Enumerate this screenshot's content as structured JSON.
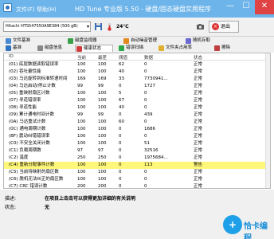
{
  "window": {
    "title": "HD Tune 专业版 5.50 - 硬盘/固态硬盘实用程序",
    "menu": [
      "文件(F)",
      "帮助(H)"
    ],
    "controls": {
      "minimize": "—",
      "maximize": "☐",
      "close": "✕"
    }
  },
  "toolbar": {
    "drive": "Hitachi HTS547550A9E384 (500 gB)",
    "temperature": "24℃",
    "exit_label": "退出"
  },
  "tabs": {
    "row1": [
      "文件基准",
      "磁盘监视器",
      "自动噪音管理",
      "随机存取"
    ],
    "row2": [
      "基准",
      "磁盘信息",
      "健康状态",
      "错误扫描",
      "文件夹占用率",
      "擦除"
    ]
  },
  "table": {
    "headers": [
      "ID",
      "当前",
      "最差",
      "阈值",
      "数据",
      "状态"
    ],
    "rows": [
      [
        "(01) 底层数据读取错误率",
        "100",
        "100",
        "62",
        "0",
        "正常"
      ],
      [
        "(02) 吞吐量性能",
        "100",
        "100",
        "40",
        "0",
        "正常"
      ],
      [
        "(03) 马达旋转到标准转速时间",
        "169",
        "169",
        "33",
        "7730941...",
        "正常"
      ],
      [
        "(04) 马达启动/停止计数",
        "99",
        "99",
        "0",
        "1727",
        "正常"
      ],
      [
        "(05) 重映射扇区计数",
        "100",
        "100",
        "5",
        "0",
        "正常"
      ],
      [
        "(07) 寻道错误率",
        "100",
        "100",
        "67",
        "0",
        "正常"
      ],
      [
        "(08) 寻道性能",
        "100",
        "100",
        "40",
        "0",
        "正常"
      ],
      [
        "(09) 累计通电时间计数",
        "99",
        "99",
        "0",
        "439",
        "正常"
      ],
      [
        "(0A) 马达重试计数",
        "100",
        "100",
        "60",
        "0",
        "正常"
      ],
      [
        "(0C) 通电周期计数",
        "100",
        "100",
        "0",
        "1686",
        "正常"
      ],
      [
        "(BF) 震动纠错错误率",
        "100",
        "100",
        "0",
        "0",
        "正常"
      ],
      [
        "(C0) 不安全关闭计数",
        "100",
        "100",
        "0",
        "51",
        "正常"
      ],
      [
        "(C1) 负载周期数",
        "97",
        "97",
        "0",
        "32516",
        "正常"
      ],
      [
        "(C2) 温度",
        "250",
        "250",
        "0",
        "1975684...",
        "正常"
      ],
      [
        "(C4) 重新分配事件计数",
        "100",
        "100",
        "0",
        "113",
        "警告"
      ],
      [
        "(C5) 当前待映射的扇区数",
        "100",
        "100",
        "0",
        "0",
        "正常"
      ],
      [
        "(C6) 脱机无法纠正的扇区数",
        "100",
        "100",
        "0",
        "0",
        "正常"
      ],
      [
        "(C7) CRC 错误计数",
        "200",
        "200",
        "0",
        "0",
        "正常"
      ]
    ],
    "highlight_index": 14,
    "highlight_color": "#fff77a"
  },
  "details": {
    "description_label": "描述:",
    "description_text": "在项目上击击可以获得更加详细的有关说明",
    "status_label": "状态:",
    "status_text": "无"
  },
  "watermark": {
    "glyph": "+",
    "text": "恰卡编程"
  },
  "colors": {
    "titlebar": "#6db4ea",
    "accent": "#1da0e8"
  }
}
